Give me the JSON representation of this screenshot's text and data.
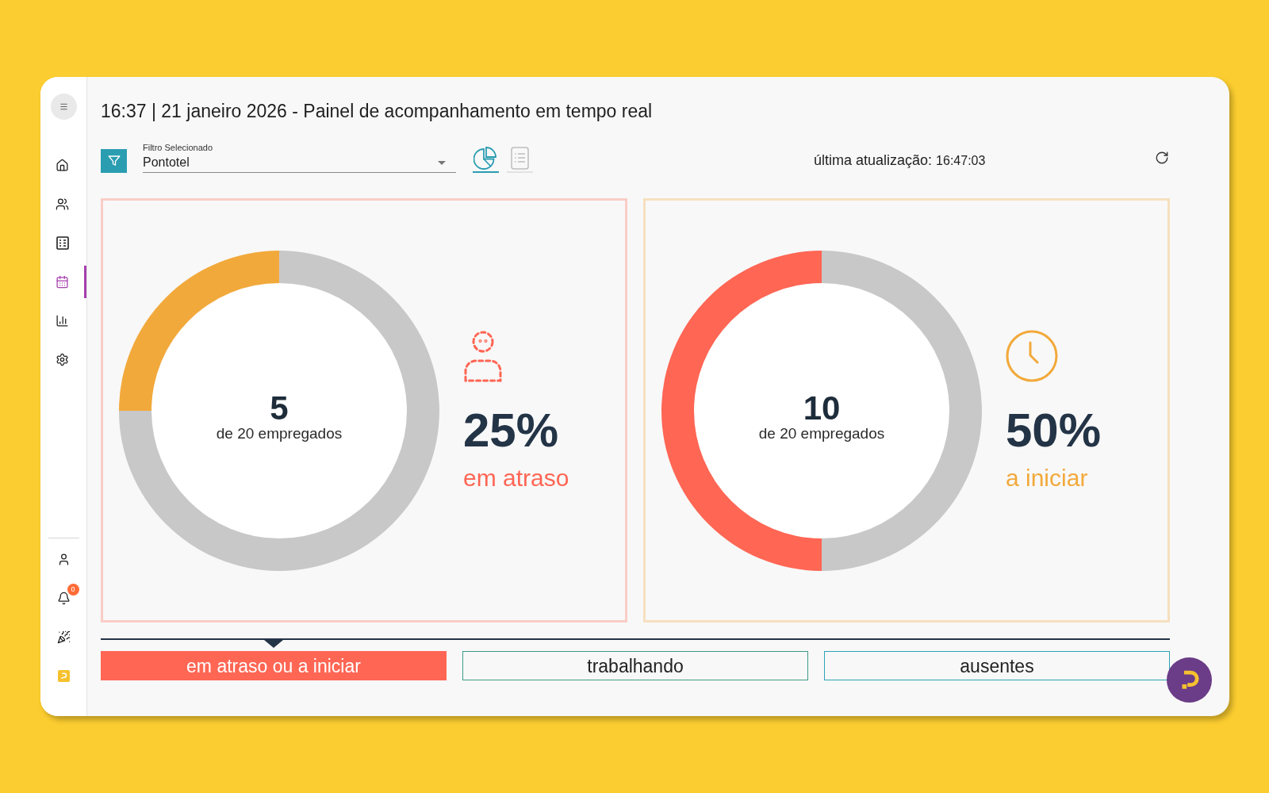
{
  "sidebar": {
    "nav_items": [
      {
        "selected": false
      },
      {
        "selected": false
      },
      {
        "selected": false
      },
      {
        "selected": true
      },
      {
        "selected": false
      },
      {
        "selected": false
      }
    ],
    "notification_badge": "0"
  },
  "header": {
    "title": "16:37 | 21 janeiro 2026 - Painel de acompanhamento em tempo real"
  },
  "toolbar": {
    "filter": {
      "label": "Filtro Selecionado",
      "value": "Pontotel"
    },
    "view_toggle": [
      {
        "selected": true
      },
      {
        "selected": false
      }
    ],
    "last_update": {
      "label": "última atualização:",
      "time": "16:47:03"
    }
  },
  "cards": [
    {
      "kind": "late",
      "color": "#ff6654",
      "count": "5",
      "count_caption": "de 20 empregados",
      "percent": "25%",
      "label": "em atraso",
      "chart_data": {
        "type": "donut",
        "values": [
          25,
          75
        ],
        "colors": [
          "#f2a93b",
          "#c8c8c8"
        ]
      }
    },
    {
      "kind": "not_started",
      "color": "#f2a93b",
      "count": "10",
      "count_caption": "de 20 empregados",
      "percent": "50%",
      "label": "a iniciar",
      "chart_data": {
        "type": "donut",
        "values": [
          50,
          50
        ],
        "colors": [
          "#ff6654",
          "#c8c8c8"
        ]
      }
    }
  ],
  "tabs": [
    {
      "label": "em atraso ou a iniciar",
      "selected": true,
      "color": "#ff6654"
    },
    {
      "label": "trabalhando",
      "selected": false,
      "color": "#3d9a86"
    },
    {
      "label": "ausentes",
      "selected": false,
      "color": "#2ea3b5"
    }
  ]
}
